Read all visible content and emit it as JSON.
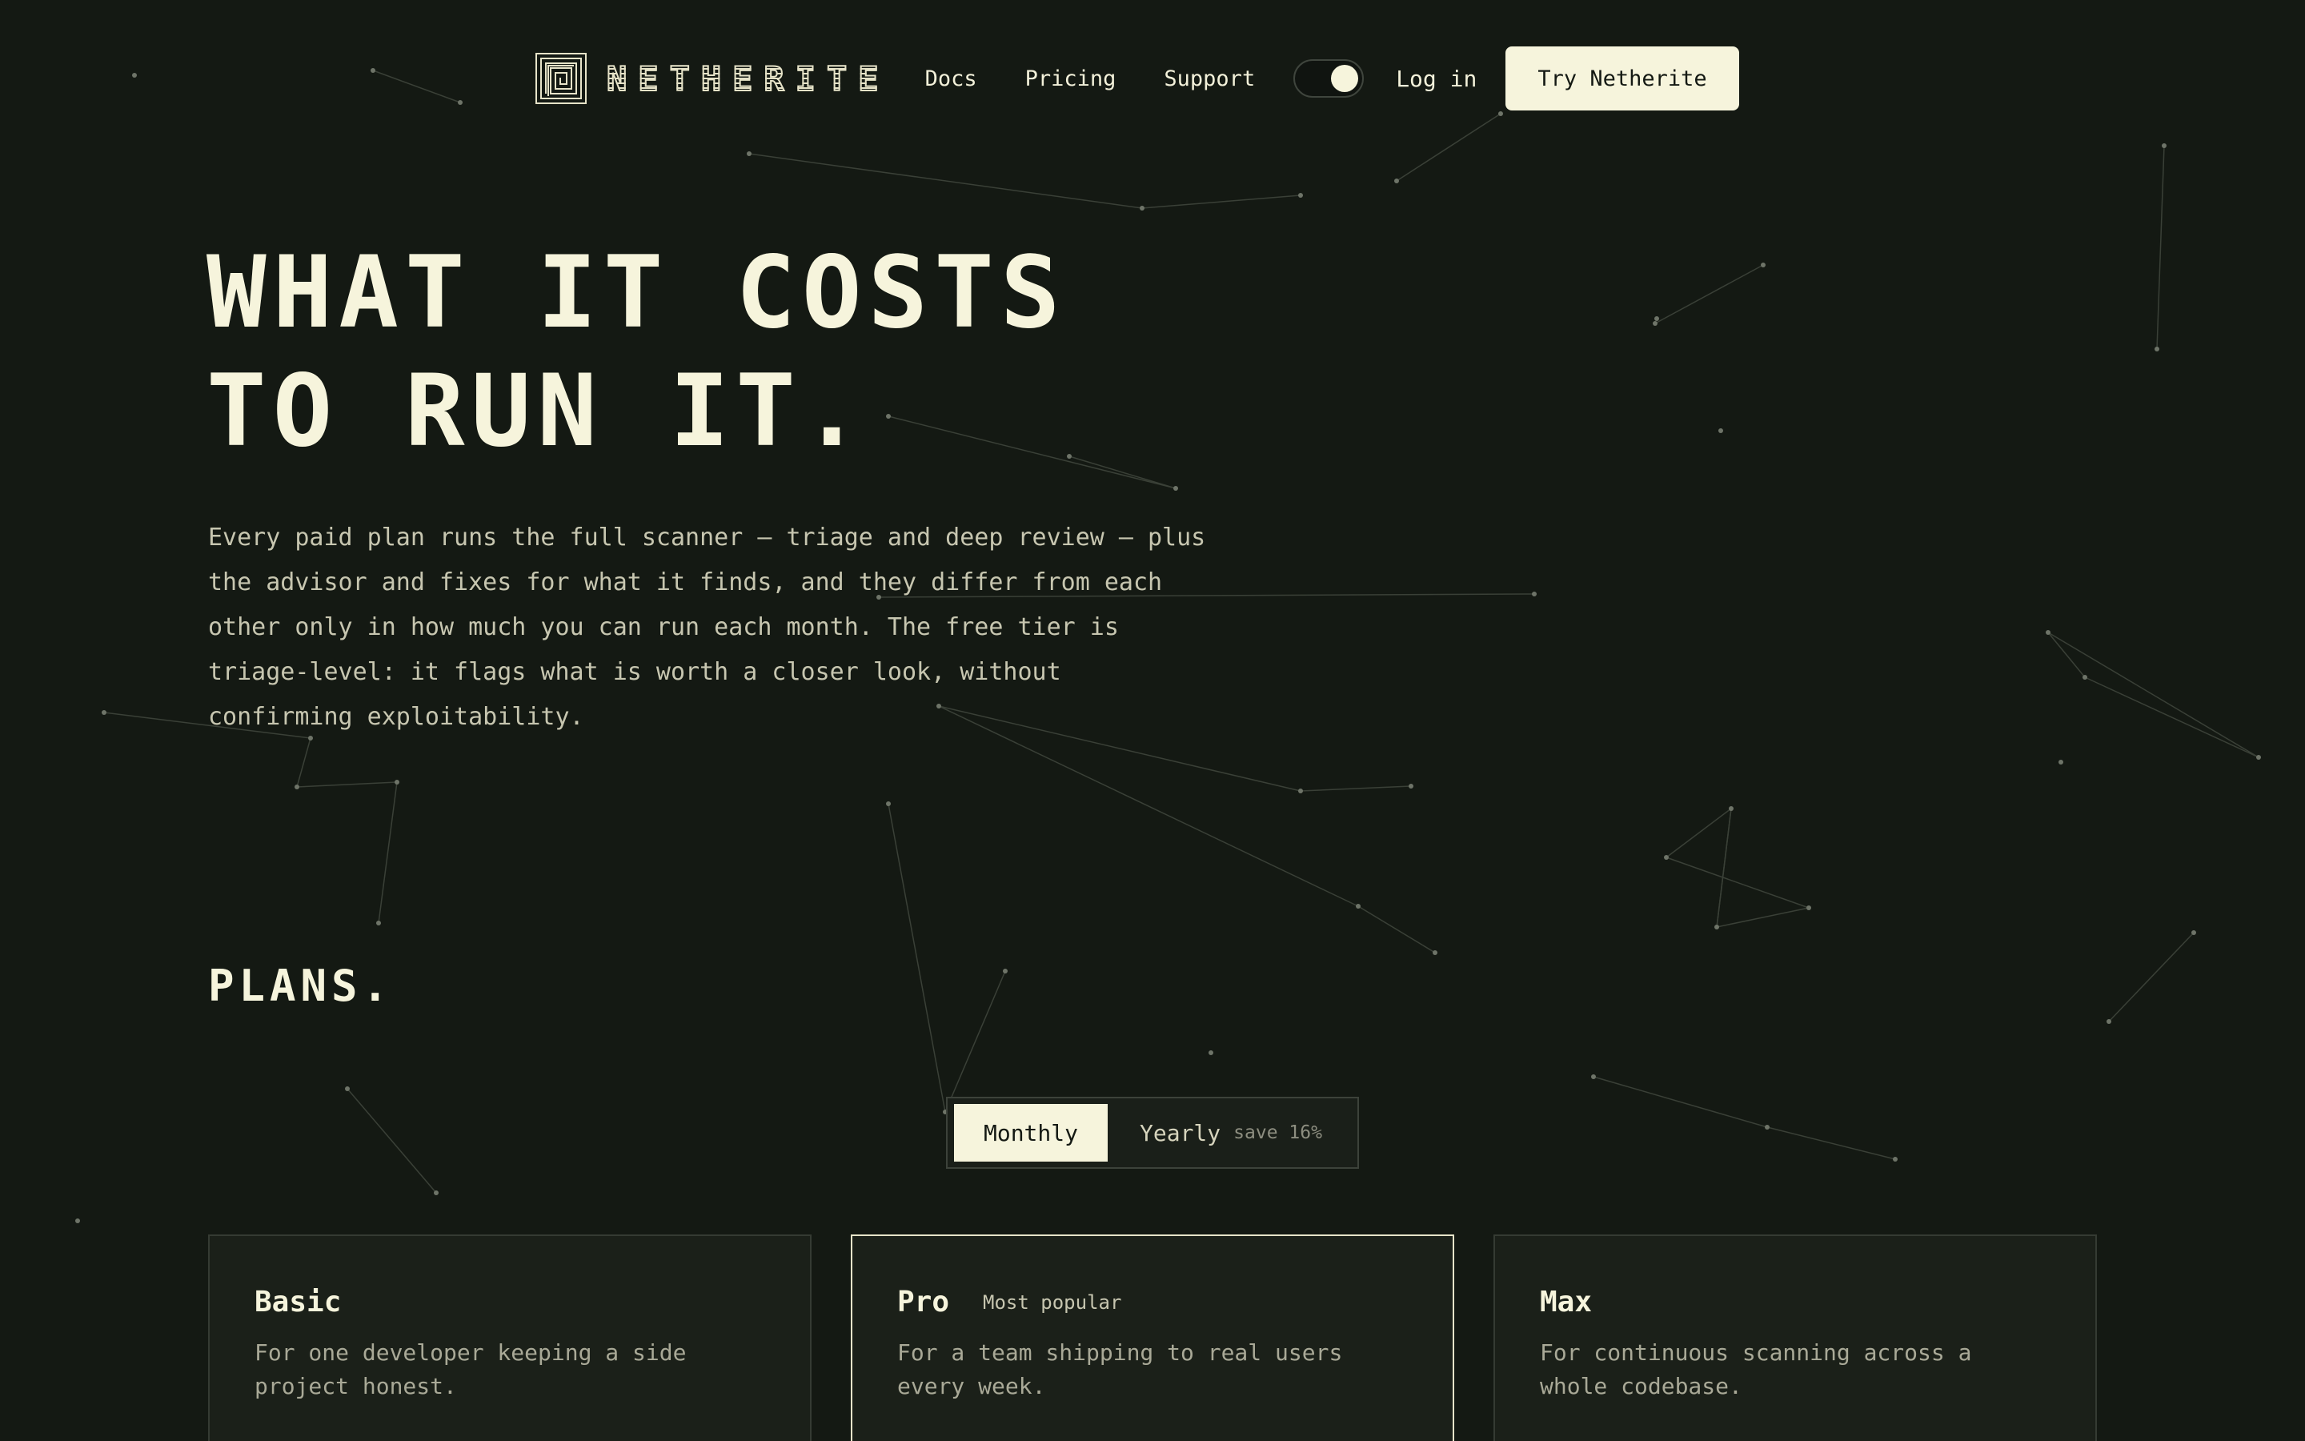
{
  "brand": {
    "name": "NETHERITE",
    "logo_icon": "maze-logo-icon"
  },
  "nav": {
    "links": [
      "Docs",
      "Pricing",
      "Support"
    ],
    "theme_toggle_icon": "theme-toggle-icon",
    "login_label": "Log in",
    "cta_label": "Try Netherite"
  },
  "hero": {
    "title_line1": "WHAT IT COSTS",
    "title_line2": "TO RUN IT.",
    "description": "Every paid plan runs the full scanner — triage and deep review — plus the advisor and fixes for what it finds, and they differ from each other only in how much you can run each month. The free tier is triage-level: it flags what is worth a closer look, without confirming exploitability."
  },
  "plans": {
    "heading": "PLANS.",
    "billing": {
      "monthly_label": "Monthly",
      "yearly_label": "Yearly",
      "yearly_badge": "save 16%",
      "selected": "Monthly"
    },
    "cards": [
      {
        "name": "Basic",
        "badge": "",
        "description": "For one developer keeping a side project honest."
      },
      {
        "name": "Pro",
        "badge": "Most popular",
        "description": "For a team shipping to real users every week."
      },
      {
        "name": "Max",
        "badge": "",
        "description": "For continuous scanning across a whole codebase."
      }
    ]
  },
  "colors": {
    "background": "#141913",
    "accent": "#f6f4dc",
    "card_background": "#1b2019"
  }
}
